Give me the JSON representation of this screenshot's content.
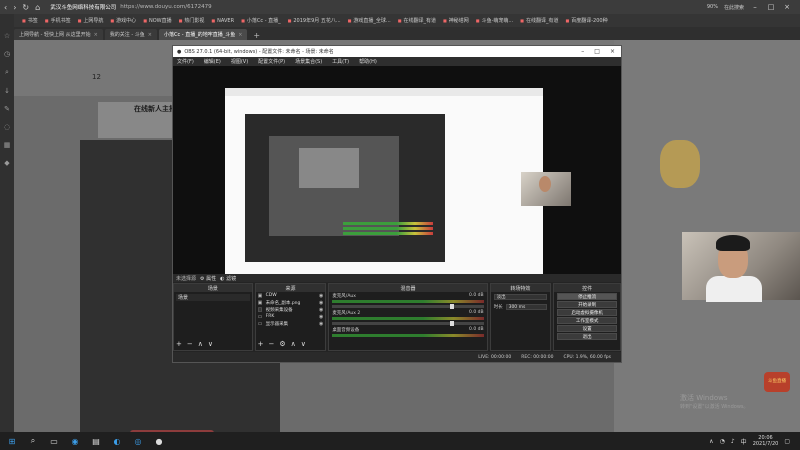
{
  "browser": {
    "site_name": "武汉斗鱼网络科技有限公司",
    "url": "https://www.douyu.com/6172479",
    "zoom": "90%",
    "search_label": "在此搜索"
  },
  "bookmarks": [
    "书签",
    "手机书签",
    "上网导航",
    "游戏中心",
    "NOW直播",
    "热门影视",
    "NAVER",
    "小落Cc - 直播_",
    "2019年9月 五花八...",
    "游戏直播_全球...",
    "在线翻译_有道",
    "神秘塔网",
    "斗鱼-萌宠萌...",
    "在线翻译_有道",
    "百度翻译-200种"
  ],
  "tabs": [
    {
      "label": "上网导航 - 轻快上网 从这里开始",
      "active": false
    },
    {
      "label": "我的关注 - 斗鱼",
      "active": false
    },
    {
      "label": "小落Cc - 直播_的地牢直播_斗鱼",
      "active": true
    }
  ],
  "page": {
    "header_number": "12",
    "streamer_title": "在线新人主播，点"
  },
  "obs": {
    "title": "OBS 27.0.1 (64-bit, windows) - 配置文件: 未命名 - 场景: 未命名",
    "menu": [
      "文件(F)",
      "编辑(E)",
      "视图(V)",
      "配置文件(P)",
      "场景集合(S)",
      "工具(T)",
      "帮助(H)"
    ],
    "status_strip": {
      "left": "未选择源",
      "props": "属性",
      "filters": "滤镜"
    },
    "docks": {
      "scenes": "场景",
      "sources": "来源",
      "mixer": "混音器",
      "transitions": "转场特效",
      "controls": "控件"
    },
    "scenes": [
      "场景"
    ],
    "sources": [
      "CDW",
      "未命名_副本.png",
      "视频采集设备",
      "FRK",
      "显示器采集"
    ],
    "mixer_tracks": [
      {
        "name": "麦克风/Aux",
        "db": "0.0 dB"
      },
      {
        "name": "麦克风/Aux 2",
        "db": "0.0 dB"
      },
      {
        "name": "桌面音频设备",
        "db": "0.0 dB"
      }
    ],
    "transition": {
      "type": "淡出",
      "duration_label": "时长",
      "duration": "300 ms"
    },
    "controls": [
      "停止推流",
      "开始录制",
      "启动虚拟摄像机",
      "工作室模式",
      "设置",
      "退出"
    ],
    "statusbar": {
      "live": "LIVE: 00:00:00",
      "rec": "REC: 00:00:00",
      "cpu": "CPU: 1.9%, 60.00 fps"
    }
  },
  "watermark": {
    "line1": "激活 Windows",
    "line2": "转到\"设置\"以激活 Windows。"
  },
  "badge_label": "斗鱼直播",
  "taskbar": {
    "time": "20:06",
    "date": "2021/7/20",
    "lang": "中"
  }
}
